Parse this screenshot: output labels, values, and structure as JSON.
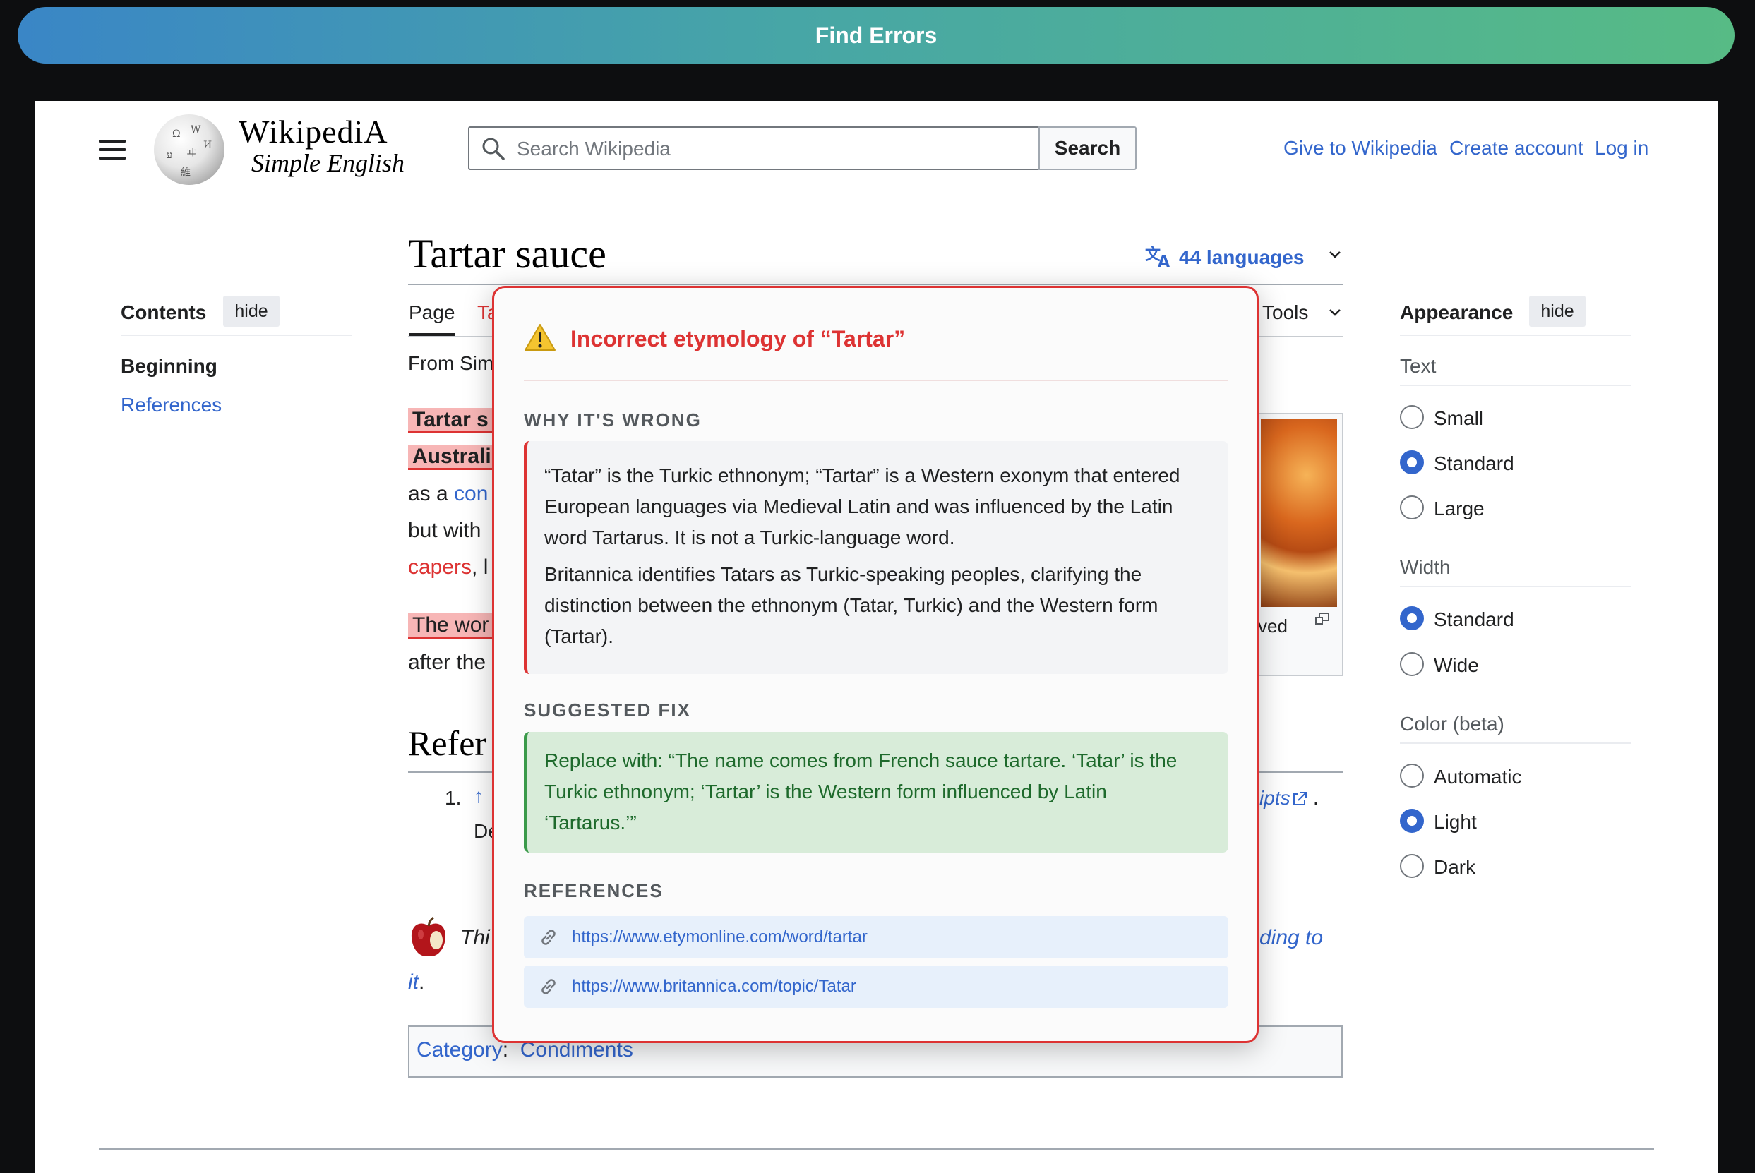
{
  "topbar": {
    "button_label": "Find Errors"
  },
  "header": {
    "wordmark": "WikipediA",
    "tagline": "Simple English",
    "search_placeholder": "Search Wikipedia",
    "search_button": "Search",
    "links": [
      "Give to Wikipedia",
      "Create account",
      "Log in"
    ]
  },
  "article": {
    "title": "Tartar sauce",
    "languages": "44 languages",
    "tabs": [
      "Page",
      "Ta"
    ],
    "tools": "Tools",
    "from_line": "From Sim",
    "body_fragments": {
      "line1": "Tartar s",
      "line2": "Australi",
      "line3a": "as a ",
      "line3b": "con",
      "line4": "but with",
      "line5a": "capers",
      "line5b": ", l",
      "line6": "The wor",
      "line7": "after the",
      "caption": "ved",
      "ref_heading": "Refer",
      "ref_num": "1.",
      "ref_arrow": "↑",
      "ref_tail": "ipts",
      "ref_dot": ".",
      "ref_de": "De",
      "stub_this": "Thi",
      "stub_right": "ding to",
      "stub_it": "it",
      "stub_dot": "."
    },
    "category_label": "Category",
    "category_colon": ":",
    "category_value": "Condiments"
  },
  "toc": {
    "title": "Contents",
    "hide": "hide",
    "items": [
      "Beginning",
      "References"
    ]
  },
  "appearance": {
    "title": "Appearance",
    "hide": "hide",
    "text": {
      "label": "Text",
      "options": [
        "Small",
        "Standard",
        "Large"
      ],
      "selected": "Standard"
    },
    "width": {
      "label": "Width",
      "options": [
        "Standard",
        "Wide"
      ],
      "selected": "Standard"
    },
    "color": {
      "label": "Color (beta)",
      "options": [
        "Automatic",
        "Light",
        "Dark"
      ],
      "selected": "Light"
    }
  },
  "popover": {
    "title": "Incorrect etymology of “Tartar”",
    "why_label": "WHY IT'S WRONG",
    "why_p1": "“Tatar” is the Turkic ethnonym; “Tartar” is a Western exonym that entered European languages via Medieval Latin and was influenced by the Latin word Tartarus. It is not a Turkic-language word.",
    "why_p2": "Britannica identifies Tatars as Turkic-speaking peoples, clarifying the distinction between the ethnonym (Tatar, Turkic) and the Western form (Tartar).",
    "fix_label": "SUGGESTED FIX",
    "fix_text": "Replace with: “The name comes from French sauce tartare. ‘Tatar’ is the Turkic ethnonym; ‘Tartar’ is the Western form influenced by Latin ‘Tartarus.’”",
    "refs_label": "REFERENCES",
    "refs": [
      "https://www.etymonline.com/word/tartar",
      "https://www.britannica.com/topic/Tatar"
    ]
  },
  "colors": {
    "accent": "#3366cc",
    "error": "#d33",
    "fix_green": "#1e6a2c"
  }
}
